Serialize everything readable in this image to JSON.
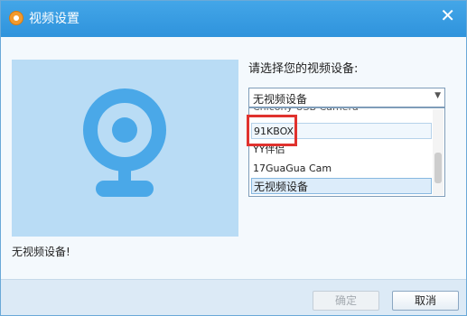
{
  "window": {
    "title": "视频设置",
    "close_glyph": "✕"
  },
  "preview": {
    "message": "无视频设备!"
  },
  "device_select": {
    "label": "请选择您的视频设备:",
    "selected": "无视频设备",
    "options": [
      "Chicony USB Camera",
      "91KBOX",
      "YY伴侣",
      "17GuaGua Cam",
      "无视频设备"
    ]
  },
  "buttons": {
    "ok": "确定",
    "cancel": "取消"
  },
  "colors": {
    "title_bar": "#3aa0e4",
    "preview_bg": "#b9dcf5",
    "camera_icon": "#4aa8e8",
    "highlight": "#e0322e"
  }
}
